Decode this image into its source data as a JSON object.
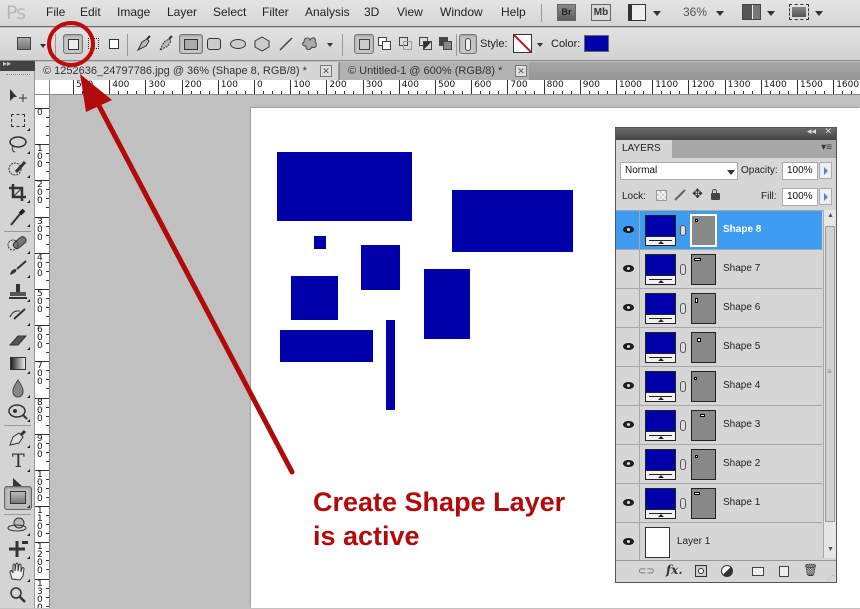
{
  "app": {
    "logo": "Ps"
  },
  "menubar": {
    "items": [
      "File",
      "Edit",
      "Image",
      "Layer",
      "Select",
      "Filter",
      "Analysis",
      "3D",
      "View",
      "Window",
      "Help"
    ],
    "bridge_label": "Br",
    "minibridge_label": "Mb",
    "zoom_value": "36%"
  },
  "options_bar": {
    "style_label": "Style:",
    "color_label": "Color:",
    "color_value": "#0000aa",
    "tool_modes": [
      "shape-layers",
      "paths",
      "fill-pixels"
    ],
    "active_mode": "shape-layers",
    "shape_tools": [
      "pen",
      "freeform-pen",
      "rectangle",
      "rounded-rectangle",
      "ellipse",
      "polygon",
      "line",
      "custom-shape"
    ],
    "active_shape_tool": "rectangle",
    "path_ops": [
      "new",
      "add",
      "subtract",
      "intersect",
      "exclude"
    ]
  },
  "tabs": [
    {
      "label": "© 1252636_24797786.jpg @ 36% (Shape 8, RGB/8) *",
      "active": true
    },
    {
      "label": "© Untitled-1 @ 600% (RGB/8) *",
      "active": false
    }
  ],
  "ruler_h": [
    "500",
    "400",
    "300",
    "200",
    "100",
    "0",
    "100",
    "200",
    "300",
    "400",
    "500",
    "600",
    "700",
    "800",
    "900",
    "1000",
    "1100",
    "1200",
    "1300",
    "1400",
    "1500",
    "1600"
  ],
  "ruler_v": [
    "0",
    "100",
    "200",
    "300",
    "400",
    "500",
    "600",
    "700",
    "800",
    "900",
    "1000",
    "1100",
    "1200",
    "1300"
  ],
  "layers_panel": {
    "title": "LAYERS",
    "blend_mode": "Normal",
    "opacity_label": "Opacity:",
    "opacity_value": "100%",
    "lock_label": "Lock:",
    "fill_label": "Fill:",
    "fill_value": "100%",
    "layers": [
      {
        "name": "Shape 8",
        "type": "shape",
        "selected": true,
        "visible": true
      },
      {
        "name": "Shape 7",
        "type": "shape",
        "selected": false,
        "visible": true
      },
      {
        "name": "Shape 6",
        "type": "shape",
        "selected": false,
        "visible": true
      },
      {
        "name": "Shape 5",
        "type": "shape",
        "selected": false,
        "visible": true
      },
      {
        "name": "Shape 4",
        "type": "shape",
        "selected": false,
        "visible": true
      },
      {
        "name": "Shape 3",
        "type": "shape",
        "selected": false,
        "visible": true
      },
      {
        "name": "Shape 2",
        "type": "shape",
        "selected": false,
        "visible": true
      },
      {
        "name": "Shape 1",
        "type": "shape",
        "selected": false,
        "visible": true
      },
      {
        "name": "Layer 1",
        "type": "pixel",
        "selected": false,
        "visible": true
      }
    ]
  },
  "annotation": {
    "line1": "Create Shape Layer",
    "line2": "is active",
    "color": "#b00a0a"
  },
  "canvas_shape_color": "#0000aa"
}
